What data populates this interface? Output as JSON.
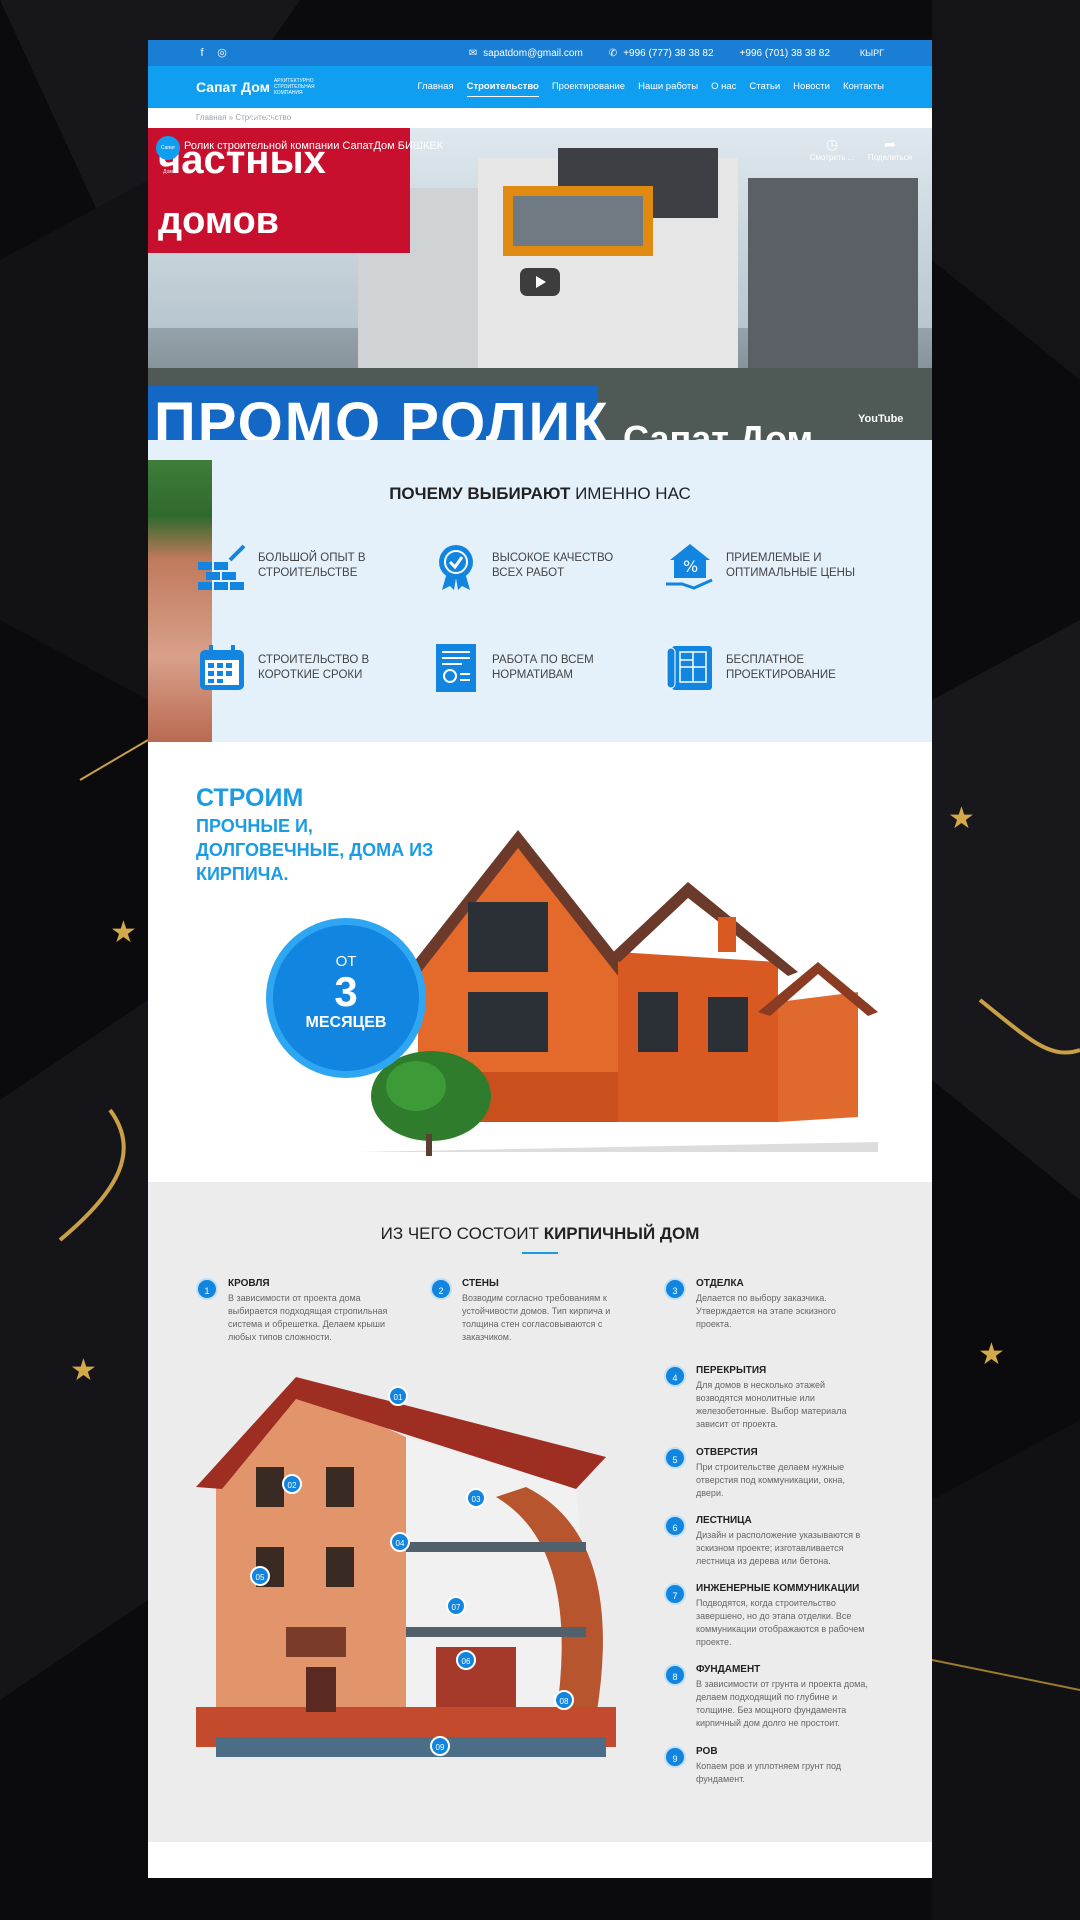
{
  "topbar": {
    "email": "sapatdom@gmail.com",
    "phone1": "+996 (777) 38 38 82",
    "phone2": "+996 (701) 38 38 82",
    "language": "КЫРГ"
  },
  "logo": {
    "name": "Сапат Дом",
    "subtitle": "АРХИТЕКТУРНО СТРОИТЕЛЬНАЯ КОМПАНИЯ"
  },
  "nav": {
    "items": [
      "Главная",
      "Строительство",
      "Проектирование",
      "Наши работы",
      "О нас",
      "Статьи",
      "Новости",
      "Контакты"
    ],
    "active": "Строительство"
  },
  "breadcrumb": "Главная » Строительство",
  "video": {
    "title": "Ролик строительной компании СапатДом БИШКЕК",
    "channel_label": "Сапат Дом",
    "watch_later": "Смотреть ...",
    "share": "Поделиться",
    "overlay_line1": "частных",
    "overlay_line2": "домов",
    "overlay_promo": "ПРОМО РОЛИК",
    "overlay_brand": "Сапат Дом",
    "youtube": "YouTube"
  },
  "why": {
    "title_bold": "ПОЧЕМУ ВЫБИРАЮТ",
    "title_rest": " ИМЕННО НАС",
    "features": [
      {
        "icon": "bricks-icon",
        "text": "Большой опыт в строительстве"
      },
      {
        "icon": "quality-medal-icon",
        "text": "Высокое качество всех работ"
      },
      {
        "icon": "price-house-icon",
        "text": "Приемлемые и оптимальные цены"
      },
      {
        "icon": "calendar-icon",
        "text": "Строительство в короткие сроки"
      },
      {
        "icon": "document-icon",
        "text": "Работа по всем нормативам"
      },
      {
        "icon": "blueprint-icon",
        "text": "Бесплатное проектирование"
      }
    ]
  },
  "build": {
    "heading_a": "СТРОИМ",
    "heading_b": "ПРОЧНЫЕ И, ДОЛГОВЕЧНЫЕ, ДОМА ИЗ КИРПИЧА.",
    "badge_from": "ОТ",
    "badge_number": "3",
    "badge_unit": "МЕСЯЦЕВ"
  },
  "composition": {
    "title_rest": "ИЗ ЧЕГО СОСТОИТ ",
    "title_bold": "КИРПИЧНЫЙ ДОМ",
    "items": [
      {
        "num": "1",
        "title": "КРОВЛЯ",
        "desc": "В зависимости от проекта дома выбирается подходящая стропильная система и обрешетка. Делаем крыши любых типов сложности."
      },
      {
        "num": "2",
        "title": "СТЕНЫ",
        "desc": "Возводим согласно требованиям к устойчивости домов. Тип кирпича и толщина стен согласовываются с заказчиком."
      },
      {
        "num": "3",
        "title": "ОТДЕЛКА",
        "desc": "Делается по выбору заказчика. Утверждается на этапе эскизного проекта."
      },
      {
        "num": "4",
        "title": "ПЕРЕКРЫТИЯ",
        "desc": "Для домов в несколько этажей возводятся монолитные или железобетонные. Выбор материала зависит от проекта."
      },
      {
        "num": "5",
        "title": "ОТВЕРСТИЯ",
        "desc": "При строительстве делаем нужные отверстия под коммуникации, окна, двери."
      },
      {
        "num": "6",
        "title": "ЛЕСТНИЦА",
        "desc": "Дизайн и расположение указываются в эскизном проекте; изготавливается лестница из дерева или бетона."
      },
      {
        "num": "7",
        "title": "ИНЖЕНЕРНЫЕ КОММУНИКАЦИИ",
        "desc": "Подводятся, когда строительство завершено, но до этапа отделки. Все коммуникации отображаются в рабочем проекте."
      },
      {
        "num": "8",
        "title": "ФУНДАМЕНТ",
        "desc": "В зависимости от грунта и проекта дома, делаем подходящий по глубине и толщине. Без мощного фундамента кирпичный дом долго не простоит."
      },
      {
        "num": "9",
        "title": "РОВ",
        "desc": "Копаем ров и уплотняем грунт под фундамент."
      }
    ],
    "markers": [
      "01",
      "02",
      "03",
      "04",
      "05",
      "06",
      "07",
      "08",
      "09"
    ]
  }
}
